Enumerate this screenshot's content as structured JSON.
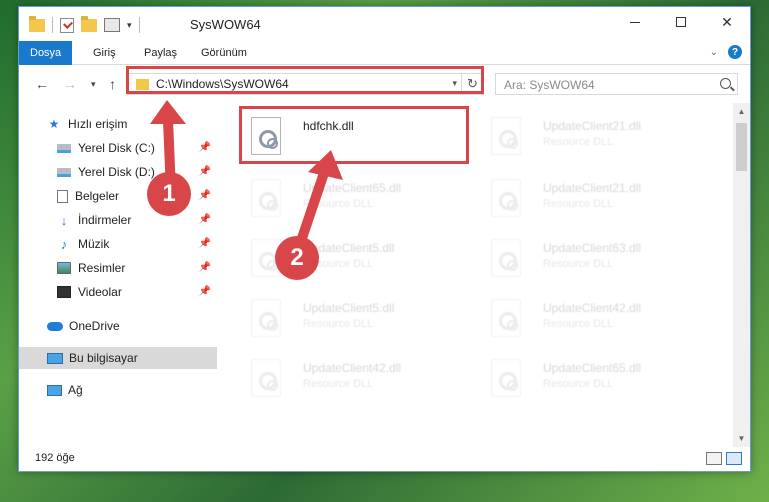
{
  "window": {
    "title": "SysWOW64",
    "accent": "#1979ca"
  },
  "ribbon": {
    "tabs": [
      "Dosya",
      "Giriş",
      "Paylaş",
      "Görünüm"
    ],
    "help_icon": "?"
  },
  "address": {
    "path": "C:\\Windows\\SysWOW64",
    "refresh_glyph": "↻",
    "search_placeholder": "Ara: SysWOW64"
  },
  "sidebar": {
    "items": [
      {
        "label": "Hızlı erişim",
        "icon": "star-icon"
      },
      {
        "label": "Yerel Disk (C:)",
        "icon": "drive-icon",
        "pinned": true
      },
      {
        "label": "Yerel Disk (D:)",
        "icon": "drive-icon",
        "pinned": true
      },
      {
        "label": "Belgeler",
        "icon": "document-icon",
        "pinned": true
      },
      {
        "label": "İndirmeler",
        "icon": "download-icon",
        "pinned": true
      },
      {
        "label": "Müzik",
        "icon": "music-icon",
        "pinned": true
      },
      {
        "label": "Resimler",
        "icon": "pictures-icon",
        "pinned": true
      },
      {
        "label": "Videolar",
        "icon": "video-icon",
        "pinned": true
      },
      {
        "label": "OneDrive",
        "icon": "cloud-icon"
      },
      {
        "label": "Bu bilgisayar",
        "icon": "pc-icon",
        "selected": true
      },
      {
        "label": "Ağ",
        "icon": "network-icon"
      }
    ]
  },
  "files": [
    {
      "name": "hdfchk.dll",
      "type": "",
      "highlighted": true
    },
    {
      "name": "UpdateClient21.dll",
      "type": "Resource DLL"
    },
    {
      "name": "UpdateClient65.dll",
      "type": "Resource DLL"
    },
    {
      "name": "UpdateClient21.dll",
      "type": "Resource DLL"
    },
    {
      "name": "UpdateClient5.dll",
      "type": "Resource DLL"
    },
    {
      "name": "UpdateClient63.dll",
      "type": "Resource DLL"
    },
    {
      "name": "UpdateClient5.dll",
      "type": "Resource DLL"
    },
    {
      "name": "UpdateClient42.dll",
      "type": "Resource DLL"
    },
    {
      "name": "UpdateClient42.dll",
      "type": "Resource DLL"
    },
    {
      "name": "UpdateClient65.dll",
      "type": "Resource DLL"
    }
  ],
  "status": {
    "count": "192 öğe"
  },
  "annotations": {
    "step1": "1",
    "step2": "2",
    "color": "#d8464a"
  }
}
